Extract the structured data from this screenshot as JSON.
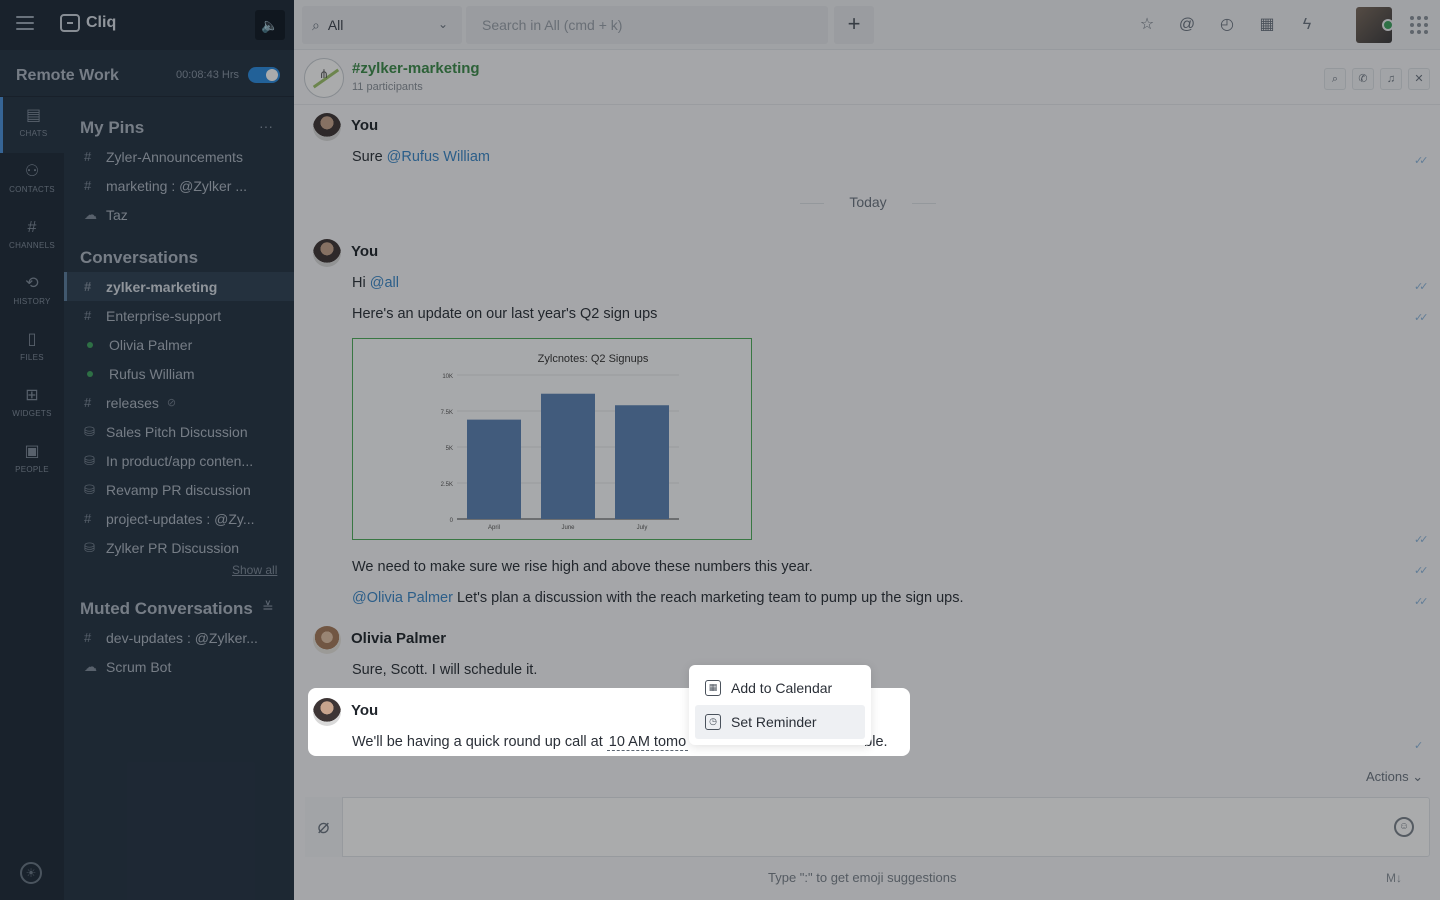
{
  "app": {
    "name": "Cliq"
  },
  "status": {
    "name": "Remote Work",
    "timer": "00:08:43 Hrs"
  },
  "rail": [
    {
      "label": "CHATS",
      "icon": "chat-icon",
      "glyph": "▤"
    },
    {
      "label": "CONTACTS",
      "icon": "contacts-icon",
      "glyph": "⚇"
    },
    {
      "label": "CHANNELS",
      "icon": "channels-icon",
      "glyph": "#"
    },
    {
      "label": "HISTORY",
      "icon": "history-icon",
      "glyph": "⟲"
    },
    {
      "label": "FILES",
      "icon": "files-icon",
      "glyph": "▯"
    },
    {
      "label": "WIDGETS",
      "icon": "widgets-icon",
      "glyph": "⊞"
    },
    {
      "label": "PEOPLE",
      "icon": "people-icon",
      "glyph": "▣"
    }
  ],
  "pins": {
    "title": "My Pins",
    "more": "···",
    "items": [
      {
        "prefix": "#",
        "label": "Zyler-Announcements"
      },
      {
        "prefix": "#",
        "label": "marketing : @Zylker ..."
      },
      {
        "prefix": "☁",
        "label": "Taz"
      }
    ]
  },
  "conversations": {
    "title": "Conversations",
    "items": [
      {
        "prefix": "#",
        "label": "zylker-marketing"
      },
      {
        "prefix": "#",
        "label": "Enterprise-support"
      },
      {
        "prefix": "dot",
        "label": "Olivia Palmer"
      },
      {
        "prefix": "dot",
        "label": "Rufus William"
      },
      {
        "prefix": "#",
        "label": "releases",
        "sub": "⊘"
      },
      {
        "prefix": "⛁",
        "label": "Sales Pitch Discussion"
      },
      {
        "prefix": "⛁",
        "label": "In product/app conten..."
      },
      {
        "prefix": "⛁",
        "label": "Revamp PR discussion"
      },
      {
        "prefix": "#",
        "label": "project-updates : @Zy..."
      },
      {
        "prefix": "⛁",
        "label": "Zylker PR Discussion"
      }
    ],
    "show_all": "Show all"
  },
  "muted": {
    "title": "Muted Conversations",
    "icon": "≚",
    "items": [
      {
        "prefix": "#",
        "label": "dev-updates : @Zylker..."
      },
      {
        "prefix": "☁",
        "label": "Scrum Bot"
      }
    ]
  },
  "search": {
    "scope": "All",
    "placeholder": "Search in All (cmd + k)"
  },
  "channel": {
    "name": "#zylker-marketing",
    "participants": "11 participants"
  },
  "messages": {
    "m1_sender": "You",
    "m1_text": "Sure ",
    "m1_mention": "@Rufus William",
    "day": "Today",
    "m2_sender": "You",
    "m2_text1": "Hi ",
    "m2_mention": "@all",
    "m2_text2": "Here's an update on our last year's Q2 sign ups",
    "m2_text3": "We need to make sure we rise high and above these numbers this year.",
    "m2_mention2": "@Olivia Palmer",
    "m2_text4": " Let's plan a discussion with the reach marketing team to pump up the sign ups.",
    "m3_sender": "Olivia Palmer",
    "m3_text": "Sure, Scott. I will schedule it.",
    "m4_sender": "You",
    "m4_text": "We'll be having a quick round up call at ",
    "m4_highlight": "10 AM tomo",
    "m4_tail": "ble."
  },
  "context_menu": {
    "add_calendar": "Add to Calendar",
    "set_reminder": "Set Reminder"
  },
  "actions": "Actions",
  "composer": {
    "hint": "Type \":\" to get emoji suggestions",
    "md": "M↓"
  },
  "chart_data": {
    "type": "bar",
    "title": "Zylcnotes: Q2 Signups",
    "categories": [
      "April",
      "June",
      "July"
    ],
    "values": [
      6900,
      8700,
      7900
    ],
    "yticks": [
      "0",
      "2.5K",
      "5K",
      "7.5K",
      "10K"
    ],
    "ylim": [
      0,
      10000
    ],
    "color": "#5b82b5"
  }
}
